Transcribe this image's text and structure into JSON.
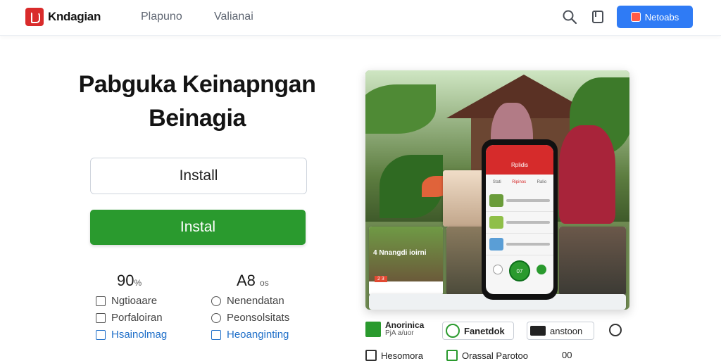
{
  "header": {
    "brand": "Kndagian",
    "nav": [
      "Plapuno",
      "Valianai"
    ],
    "cta_label": "Netoabs",
    "icons": [
      "search-icon",
      "bookmark-icon",
      "logo-shield-icon"
    ]
  },
  "hero": {
    "title_line1": "Pabguka Keinapngan",
    "title_line2": "Beinagia",
    "install_outline": "Install",
    "install_primary": "Instal"
  },
  "stats": [
    {
      "value": "90",
      "unit": "%"
    },
    {
      "value": "A8",
      "unit": "os"
    }
  ],
  "features": [
    {
      "label": "Ngtioaare",
      "icon": "flag-icon"
    },
    {
      "label": "Nenendatan",
      "icon": "thumb-icon"
    },
    {
      "label": "Porfaloiran",
      "icon": "document-icon"
    },
    {
      "label": "Peonsolsitats",
      "icon": "settings-icon"
    },
    {
      "label": "Hsainolmag",
      "icon": "edit-icon"
    },
    {
      "label": "Heoanginting",
      "icon": "image-icon"
    }
  ],
  "phone": {
    "header": "Rplidis",
    "tabs": [
      "Stati",
      "Ripinos",
      "Ralio"
    ],
    "fab": "07"
  },
  "image_cards": {
    "left_title": "4 Nnangdi ioirni",
    "left_badge": "2 3"
  },
  "bottom": {
    "chip1_label": "Anorinica",
    "chip1_sub": "PjA a/uor",
    "chip2_label": "Fanetdok",
    "chip3_label": "anstoon",
    "row2_label1": "Hesomora",
    "row2_label2": "Orassal Parotoo",
    "row2_label3": "00"
  },
  "colors": {
    "brand_red": "#d92b2b",
    "cta_blue": "#2f7bf5",
    "green": "#2a9a2e"
  }
}
